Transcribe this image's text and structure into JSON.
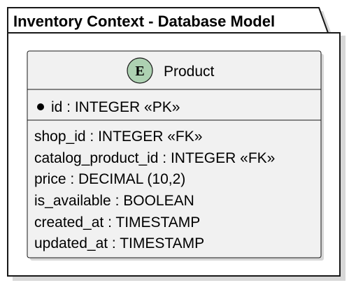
{
  "package": {
    "title": "Inventory Context - Database Model"
  },
  "entity": {
    "stereotype_letter": "E",
    "stereotype_color": "#ADD1B2",
    "name": "Product",
    "primary_keys": [
      {
        "text": "id : INTEGER «PK»"
      }
    ],
    "fields": [
      {
        "text": "shop_id : INTEGER «FK»"
      },
      {
        "text": "catalog_product_id : INTEGER «FK»"
      },
      {
        "text": "price : DECIMAL (10,2)"
      },
      {
        "text": "is_available : BOOLEAN"
      },
      {
        "text": "created_at : TIMESTAMP"
      },
      {
        "text": "updated_at : TIMESTAMP"
      }
    ]
  },
  "colors": {
    "entity_fill": "#F1F1F1",
    "border": "#181818",
    "package_fill": "#FFFFFF"
  }
}
